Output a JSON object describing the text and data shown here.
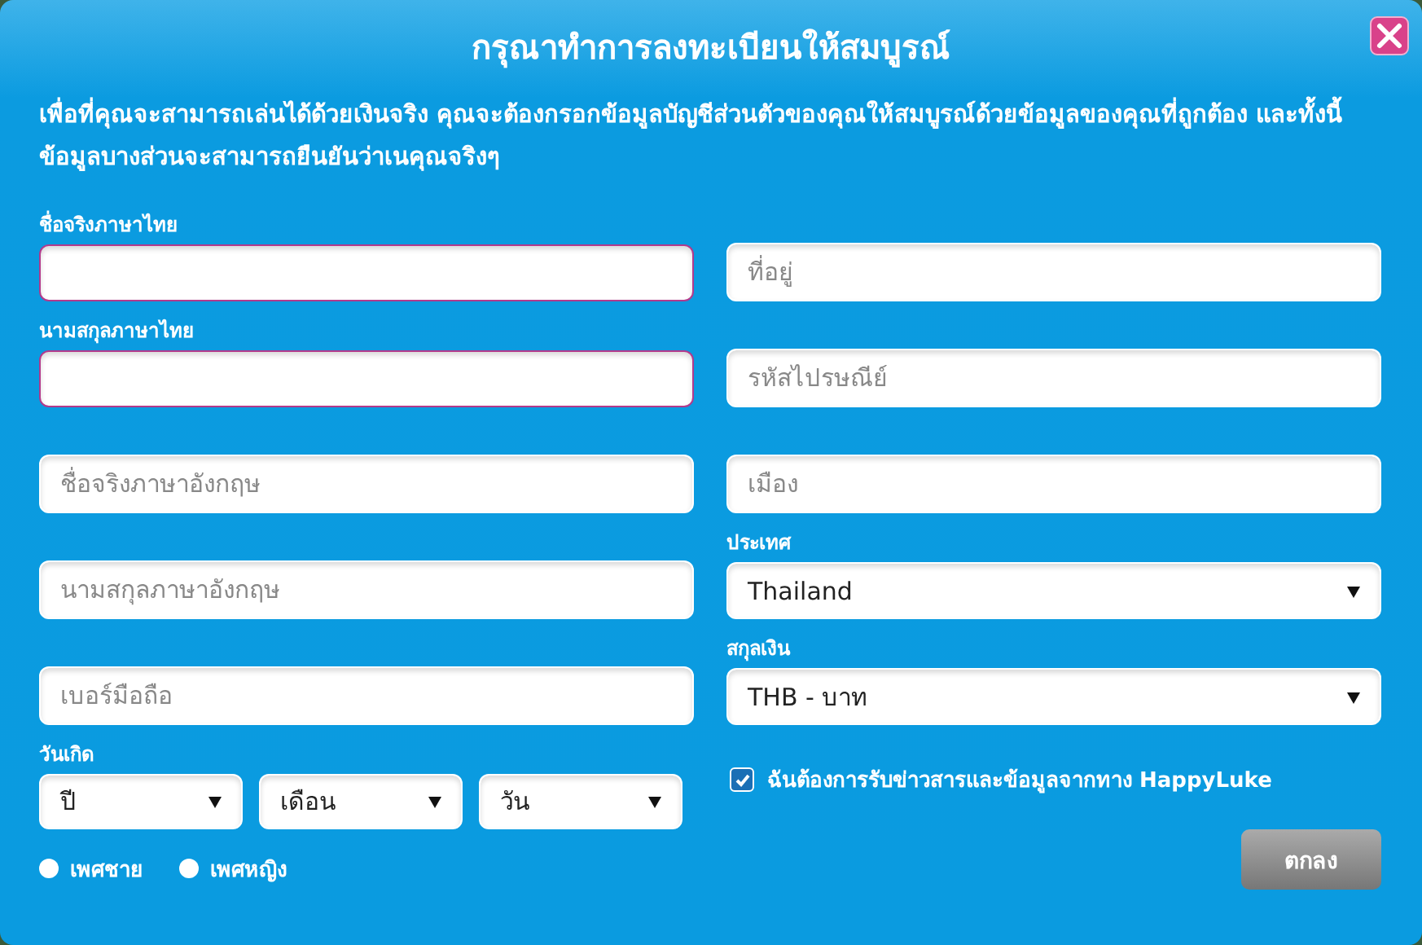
{
  "dialog": {
    "title": "กรุณาทำการลงทะเบียนให้สมบูรณ์",
    "description": "เพื่อที่คุณจะสามารถเล่นได้ด้วยเงินจริง คุณจะต้องกรอกข้อมูลบัญชีส่วนตัวของคุณให้สมบูรณ์ด้วยข้อมูลของคุณที่ถูกต้อง และทั้งนี้ ข้อมูลบางส่วนจะสามารถยืนยันว่าเนคุณจริงๆ"
  },
  "rows": [
    {
      "left": {
        "kind": "input",
        "label": "ชื่อจริงภาษาไทย",
        "invalid": true
      },
      "right": {
        "kind": "input",
        "placeholder": "ที่อยู่",
        "invalid": false
      }
    },
    {
      "left": {
        "kind": "input",
        "label": "นามสกุลภาษาไทย",
        "invalid": true
      },
      "right": {
        "kind": "input",
        "placeholder": "รหัสไปรษณีย์",
        "invalid": false
      }
    },
    {
      "left": {
        "kind": "input",
        "placeholder": "ชื่อจริงภาษาอังกฤษ",
        "invalid": false
      },
      "right": {
        "kind": "input",
        "placeholder": "เมือง",
        "invalid": false
      }
    },
    {
      "left": {
        "kind": "input",
        "placeholder": "นามสกุลภาษาอังกฤษ",
        "invalid": false
      },
      "right": {
        "kind": "select",
        "label": "ประเทศ",
        "value": "Thailand"
      }
    },
    {
      "left": {
        "kind": "input",
        "placeholder": "เบอร์มือถือ",
        "invalid": false
      },
      "right": {
        "kind": "select",
        "label": "สกุลเงิน",
        "value": "THB - บาท"
      }
    }
  ],
  "birthdate": {
    "label": "วันเกิด",
    "selects": [
      "ปี",
      "เดือน",
      "วัน"
    ]
  },
  "gender": [
    {
      "label": "เพศชาย",
      "selected": false
    },
    {
      "label": "เพศหญิง",
      "selected": false
    }
  ],
  "newsletter": {
    "label": "ฉันต้องการรับข่าวสารและข้อมูลจากทาง HappyLuke",
    "checked": true
  },
  "submit": "ตกลง"
}
